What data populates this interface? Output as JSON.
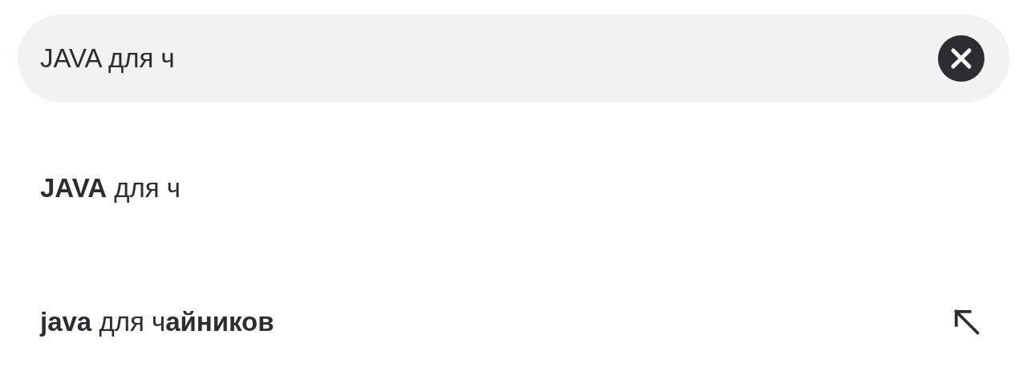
{
  "search": {
    "value": "JAVA для ч",
    "clear_button": true
  },
  "suggestions": [
    {
      "text": "**JAVA** для ч",
      "fill_arrow": false
    },
    {
      "text": "**java** для ч**айников**",
      "fill_arrow": true
    }
  ]
}
